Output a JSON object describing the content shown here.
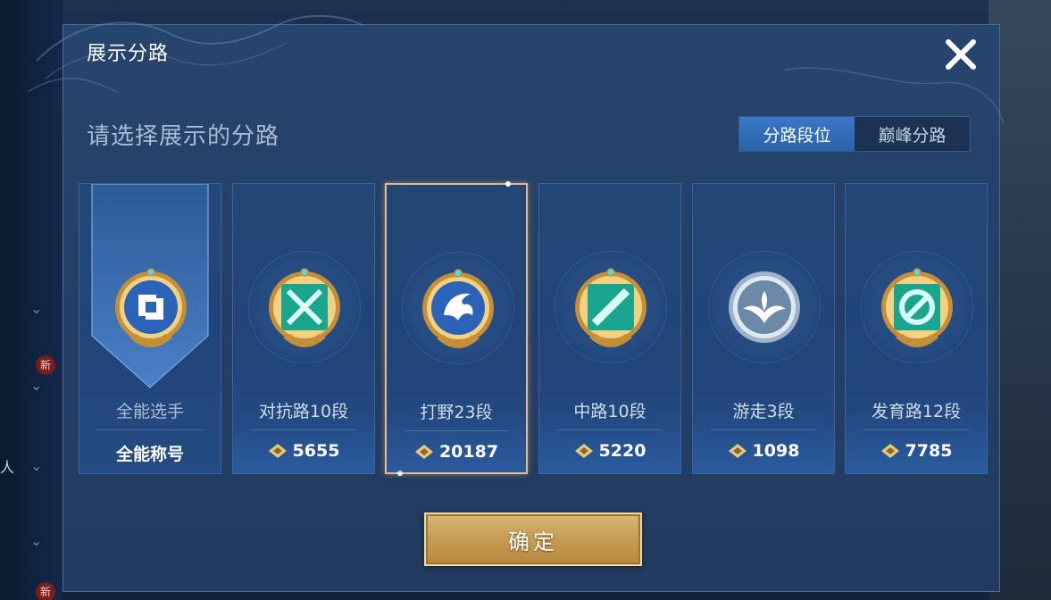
{
  "background": {
    "side_badge_new": "新",
    "side_char": "人"
  },
  "modal": {
    "title": "展示分路",
    "subtitle": "请选择展示的分路",
    "toggle": {
      "options": [
        {
          "label": "分路段位",
          "active": true
        },
        {
          "label": "巅峰分路",
          "active": false
        }
      ]
    },
    "cards": [
      {
        "id": "all",
        "name": "全能选手",
        "title": "全能称号",
        "selected": false
      },
      {
        "id": "clash",
        "name": "对抗路10段",
        "score": "5655",
        "selected": false
      },
      {
        "id": "jungle",
        "name": "打野23段",
        "score": "20187",
        "selected": true
      },
      {
        "id": "mid",
        "name": "中路10段",
        "score": "5220",
        "selected": false
      },
      {
        "id": "roam",
        "name": "游走3段",
        "score": "1098",
        "selected": false
      },
      {
        "id": "farm",
        "name": "发育路12段",
        "score": "7785",
        "selected": false
      }
    ],
    "confirm_label": "确定"
  },
  "colors": {
    "accent_blue": "#2b62ab",
    "gold": "#c79d55",
    "selected_border": "#e9b98a"
  }
}
